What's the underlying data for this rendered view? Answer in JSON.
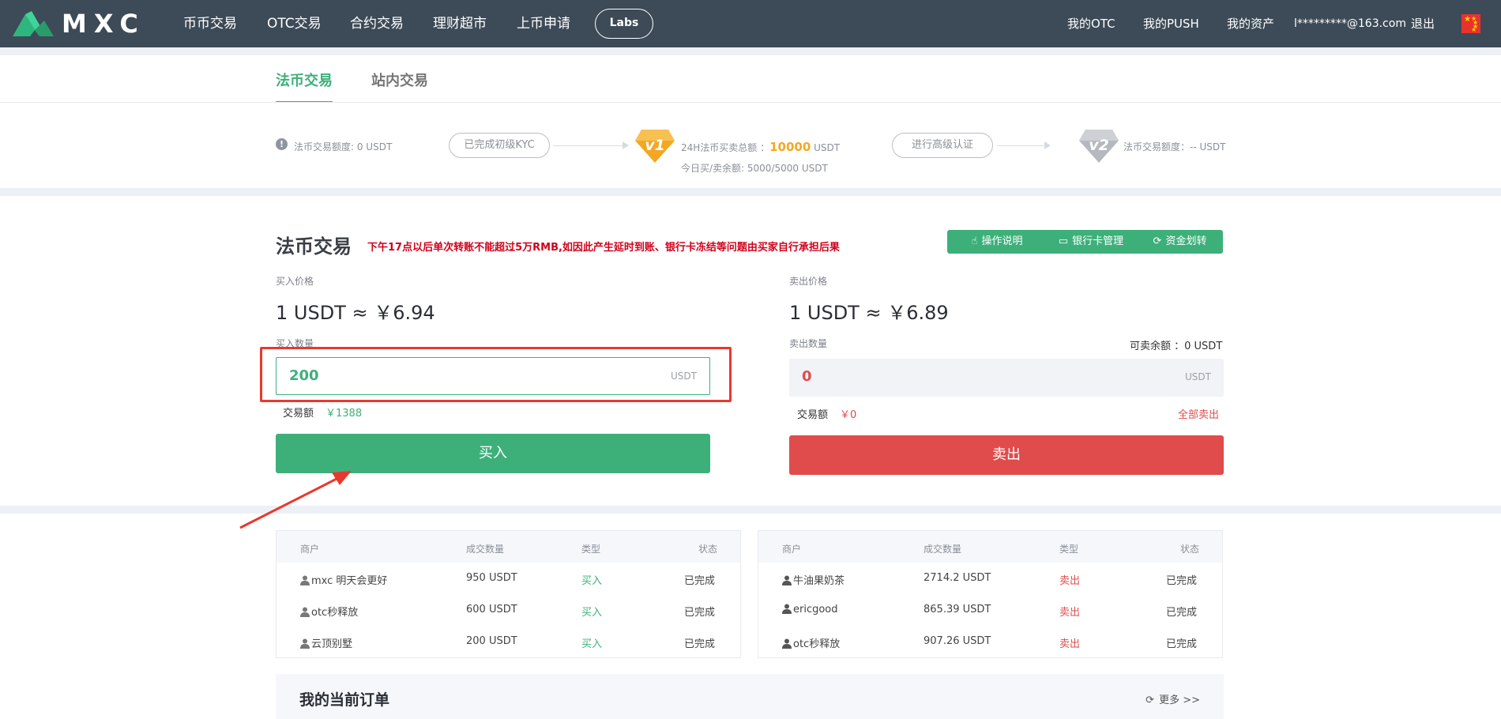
{
  "nav": {
    "logo_text": "MXC",
    "items": [
      "币币交易",
      "OTC交易",
      "合约交易",
      "理财超市",
      "上币申请"
    ],
    "labs": "Labs",
    "right_items": [
      "我的OTC",
      "我的PUSH",
      "我的资产"
    ],
    "email": "l*********@163.com",
    "logout": "退出"
  },
  "tabs": [
    "法币交易",
    "站内交易"
  ],
  "kyc": {
    "limit_text": "法币交易额度: 0 USDT",
    "step1_button": "已完成初级KYC",
    "v1_badge": "v1",
    "v1_total_label": "24H法币买卖总额 ：",
    "v1_total_value": "10000",
    "v1_total_unit": " USDT",
    "v1_remaining": "今日买/卖余额: 5000/5000 USDT",
    "step2_button": "进行高级认证",
    "v2_badge": "v2",
    "v2_text": "法币交易额度：-- USDT"
  },
  "trade": {
    "title": "法币交易",
    "notice": "下午17点以后单次转账不能超过5万RMB,如因此产生延时到账、银行卡冻结等问题由买家自行承担后果",
    "buttons": [
      "操作说明",
      "银行卡管理",
      "资金划转"
    ],
    "buy": {
      "price_label": "买入价格",
      "price": "1 USDT ≈ ￥6.94",
      "qty_label": "买入数量",
      "qty_value": "200",
      "unit": "USDT",
      "amount_label": "交易额",
      "amount_value": "￥1388",
      "button": "买入"
    },
    "sell": {
      "price_label": "卖出价格",
      "price": "1 USDT ≈ ￥6.89",
      "qty_label": "卖出数量",
      "available": "可卖余额 ：0 USDT",
      "qty_value": "0",
      "unit": "USDT",
      "amount_label": "交易额",
      "amount_value": "￥0",
      "sell_all": "全部卖出",
      "button": "卖出"
    }
  },
  "tables": {
    "headers": [
      "商户",
      "成交数量",
      "类型",
      "状态"
    ],
    "buy_rows": [
      {
        "merchant": "mxc 明天会更好",
        "qty": "950 USDT",
        "type": "买入",
        "status": "已完成"
      },
      {
        "merchant": "otc秒释放",
        "qty": "600 USDT",
        "type": "买入",
        "status": "已完成"
      },
      {
        "merchant": "云顶别墅",
        "qty": "200 USDT",
        "type": "买入",
        "status": "已完成"
      }
    ],
    "sell_rows": [
      {
        "merchant": "牛油果奶茶",
        "qty": "2714.2 USDT",
        "type": "卖出",
        "status": "已完成"
      },
      {
        "merchant": "ericgood",
        "qty": "865.39 USDT",
        "type": "卖出",
        "status": "已完成"
      },
      {
        "merchant": "otc秒释放",
        "qty": "907.26 USDT",
        "type": "卖出",
        "status": "已完成"
      }
    ]
  },
  "orders": {
    "title": "我的当前订单",
    "more": "更多 >>"
  },
  "colors": {
    "brand_green": "#3db07a",
    "sell_red": "#e04b4b",
    "nav_bg": "#3d4a57",
    "gold": "#f5a623"
  }
}
